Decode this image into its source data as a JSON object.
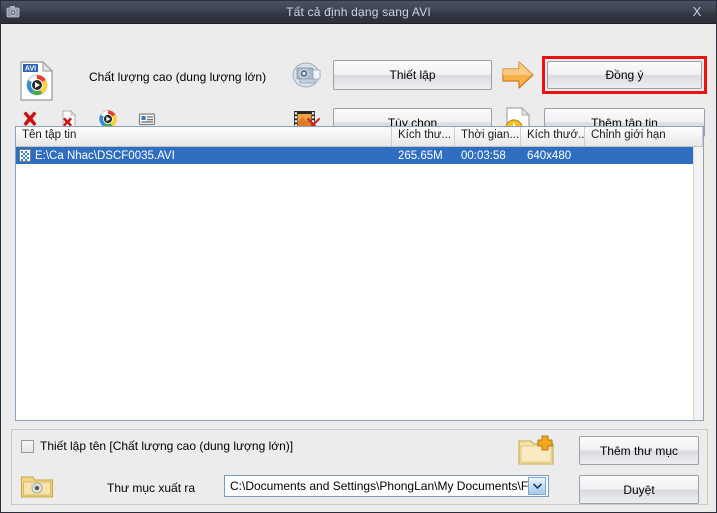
{
  "window": {
    "title": "Tất cả định dạng sang AVI",
    "close_label": "X",
    "titlebar_icon": "camera-icon",
    "accent_highlight_color": "#ee1111",
    "titlebar_color": "#3a404d",
    "selection_color": "#2f6dc0"
  },
  "toolbar": {
    "format_icon": "avi-file-icon",
    "quality_label": "Chất lượng cao (dung lượng lớn)",
    "mini_icons": [
      {
        "name": "remove-all-icon"
      },
      {
        "name": "remove-file-icon"
      },
      {
        "name": "media-player-icon"
      },
      {
        "name": "file-details-icon"
      }
    ],
    "settings_icon": "video-settings-icon",
    "options_icon": "film-scissors-icon",
    "arrow_icon": "arrow-right-icon",
    "addfile_icon": "file-add-icon",
    "setup_label": "Thiết lập",
    "ok_label": "Đồng ý",
    "options_label": "Tùy chọn",
    "addfile_label": "Thêm tập tin"
  },
  "file_list": {
    "columns": [
      {
        "key": "name",
        "label": "Tên tập tin"
      },
      {
        "key": "size",
        "label": "Kích thư..."
      },
      {
        "key": "time",
        "label": "Thời gian..."
      },
      {
        "key": "dim",
        "label": "Kích thướ..."
      },
      {
        "key": "limit",
        "label": "Chỉnh giới hạn"
      }
    ],
    "rows": [
      {
        "icon": "video-file-icon",
        "name": "E:\\Ca Nhac\\DSCF0035.AVI",
        "size": "265.65M",
        "time": "00:03:58",
        "dim": "640x480",
        "limit": "",
        "selected": true
      }
    ]
  },
  "bottom": {
    "rename_checkbox_label": "Thiết lập tên [Chất lượng cao (dung lượng lớn)]",
    "rename_checkbox_checked": false,
    "output_folder_icon": "output-folder-icon",
    "output_dir_label": "Thư mục xuất ra",
    "output_dir_value": "C:\\Documents and Settings\\PhongLan\\My Documents\\FFOutp",
    "add_folder_icon": "folder-add-icon",
    "add_folder_label": "Thêm thư mục",
    "browse_label": "Duyệt"
  }
}
